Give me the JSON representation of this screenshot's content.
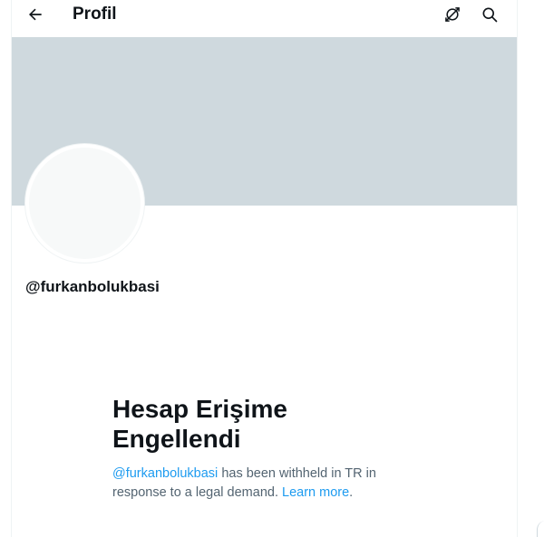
{
  "header": {
    "title": "Profil",
    "back_icon": "arrow-left-icon",
    "refresh_icon": "refresh-icon",
    "search_icon": "search-icon"
  },
  "profile": {
    "handle": "@furkanbolukbasi"
  },
  "withheld": {
    "title": "Hesap Erişime Engellendi",
    "mention": "@furkanbolukbasi",
    "message_part1": " has been withheld in TR in response to a legal demand. ",
    "learn_more": "Learn more",
    "message_end": "."
  },
  "colors": {
    "banner": "#cfd9de",
    "link": "#1d9bf0",
    "text_primary": "#0f1419",
    "text_secondary": "#536471"
  }
}
